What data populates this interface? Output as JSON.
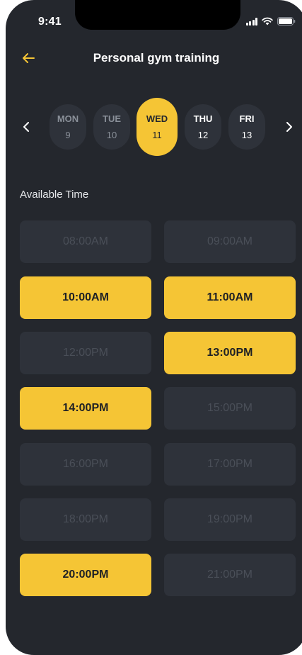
{
  "status_bar": {
    "time": "9:41"
  },
  "header": {
    "title": "Personal gym training"
  },
  "days": [
    {
      "name": "MON",
      "num": "9"
    },
    {
      "name": "TUE",
      "num": "10"
    },
    {
      "name": "WED",
      "num": "11"
    },
    {
      "name": "THU",
      "num": "12"
    },
    {
      "name": "FRI",
      "num": "13"
    }
  ],
  "selected_day": "WED 11",
  "section_label": "Available Time",
  "slots": [
    {
      "time": "08:00AM",
      "available": false
    },
    {
      "time": "09:00AM",
      "available": false
    },
    {
      "time": "10:00AM",
      "available": true
    },
    {
      "time": "11:00AM",
      "available": true
    },
    {
      "time": "12:00PM",
      "available": false
    },
    {
      "time": "13:00PM",
      "available": true
    },
    {
      "time": "14:00PM",
      "available": true
    },
    {
      "time": "15:00PM",
      "available": false
    },
    {
      "time": "16:00PM",
      "available": false
    },
    {
      "time": "17:00PM",
      "available": false
    },
    {
      "time": "18:00PM",
      "available": false
    },
    {
      "time": "19:00PM",
      "available": false
    },
    {
      "time": "20:00PM",
      "available": true
    },
    {
      "time": "21:00PM",
      "available": false
    }
  ],
  "colors": {
    "accent": "#f5c535",
    "background": "#24272d",
    "slot_disabled": "#2e323a"
  },
  "icons": {
    "back": "arrow-left-icon",
    "prev": "chevron-left-icon",
    "next": "chevron-right-icon",
    "signal": "signal-icon",
    "wifi": "wifi-icon",
    "battery": "battery-icon"
  }
}
